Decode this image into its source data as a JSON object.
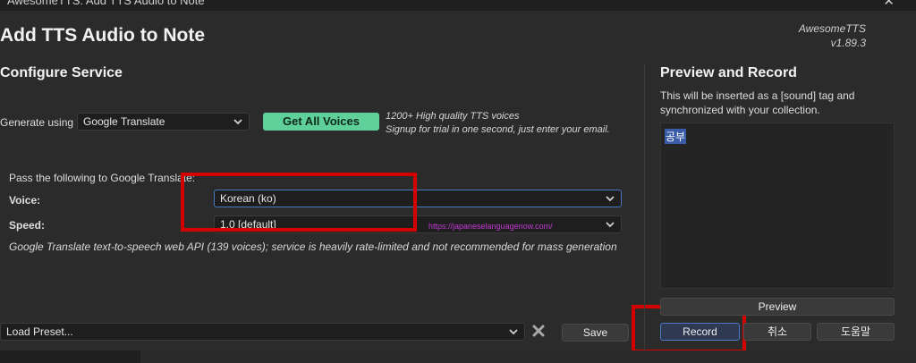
{
  "window": {
    "title": "AwesomeTTS: Add TTS Audio to Note",
    "close_glyph": "✕"
  },
  "dialog": {
    "title": "Add TTS Audio to Note",
    "brand_name": "AwesomeTTS",
    "brand_version": "v1.89.3"
  },
  "configure": {
    "heading": "Configure Service",
    "generate_label": "Generate using",
    "service_value": "Google Translate",
    "get_voices_label": "Get All Voices",
    "promo_line1": "1200+ High quality TTS voices",
    "promo_line2": "Signup for trial in one second, just enter your email.",
    "pass_label": "Pass the following to Google Translate:",
    "voice_label": "Voice:",
    "voice_value": "Korean (ko)",
    "speed_label": "Speed:",
    "speed_value": "1.0 [default]",
    "watermark": "https://japaneselanguagenow.com/",
    "description": "Google Translate text-to-speech web API (139 voices); service is heavily rate-limited and not recommended for mass generation"
  },
  "preset": {
    "placeholder": "Load Preset...",
    "save_label": "Save"
  },
  "preview": {
    "heading": "Preview and Record",
    "info": "This will be inserted as a [sound] tag and synchronized with your collection.",
    "text": "공부",
    "preview_label": "Preview",
    "record_label": "Record",
    "cancel_label": "취소",
    "help_label": "도움말"
  },
  "colors": {
    "accent_green": "#5fd09a",
    "highlight_red": "#d40000",
    "focus_blue": "#4a78c4"
  }
}
